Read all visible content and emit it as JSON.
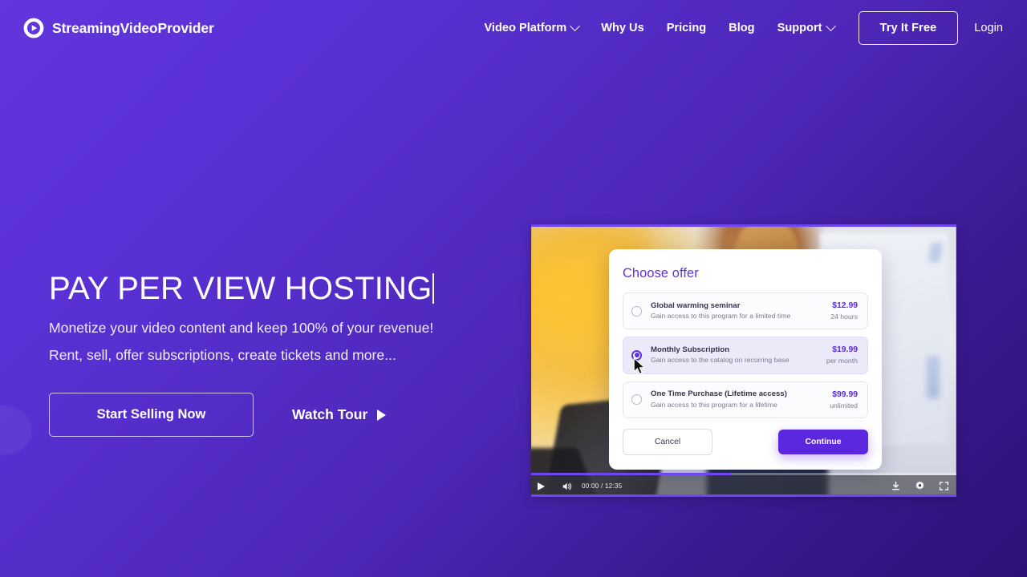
{
  "brand": {
    "name": "StreamingVideoProvider",
    "logo_icon": "play-circle-icon"
  },
  "nav": {
    "items": [
      {
        "label": "Video Platform",
        "has_dropdown": true
      },
      {
        "label": "Why Us",
        "has_dropdown": false
      },
      {
        "label": "Pricing",
        "has_dropdown": false
      },
      {
        "label": "Blog",
        "has_dropdown": false
      },
      {
        "label": "Support",
        "has_dropdown": true
      }
    ],
    "cta_label": "Try It Free",
    "login_label": "Login"
  },
  "hero": {
    "title": "PAY PER VIEW HOSTING",
    "subtitle_line1": "Monetize your video content and keep 100% of your revenue!",
    "subtitle_line2": "Rent, sell, offer subscriptions, create tickets and more...",
    "primary_cta": "Start Selling Now",
    "secondary_cta": "Watch Tour"
  },
  "player": {
    "time_display": "00:00 / 12:35",
    "progress_percent": 47,
    "play_icon": "play-icon",
    "volume_icon": "volume-icon",
    "download_icon": "download-icon",
    "settings_icon": "gear-icon",
    "fullscreen_icon": "fullscreen-icon"
  },
  "offer_dialog": {
    "title": "Choose offer",
    "offers": [
      {
        "name": "Global warming seminar",
        "description": "Gain access to this program for a limited time",
        "price": "$12.99",
        "period": "24 hours",
        "selected": false
      },
      {
        "name": "Monthly Subscription",
        "description": "Gain access to the catalog on recurring base",
        "price": "$19.99",
        "period": "per month",
        "selected": true
      },
      {
        "name": "One Time Purchase (Lifetime access)",
        "description": "Gain access to this program for a lifetime",
        "price": "$99.99",
        "period": "unlimited",
        "selected": false
      }
    ],
    "cancel_label": "Cancel",
    "continue_label": "Continue"
  },
  "colors": {
    "brand_purple": "#5b28e0",
    "accent_purple": "#6131e0",
    "bg_gradient_start": "#6136dd",
    "bg_gradient_end": "#2d1176"
  }
}
